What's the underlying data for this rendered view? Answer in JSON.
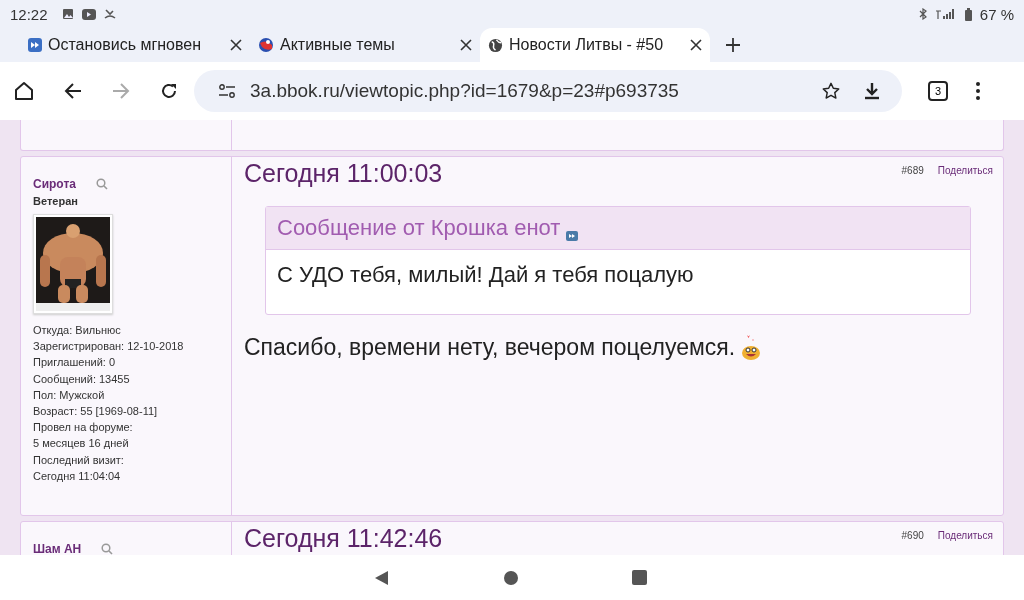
{
  "status_bar": {
    "time": "12:22",
    "battery": "67 %"
  },
  "tabs": [
    {
      "title": "Остановись мгновен",
      "selected": false,
      "kind": "forward"
    },
    {
      "title": "Активные темы",
      "selected": false,
      "kind": "ball"
    },
    {
      "title": "Новости Литвы - #50",
      "selected": true,
      "kind": "globe"
    }
  ],
  "address_bar": {
    "url": "3a.bbok.ru/viewtopic.php?id=1679&p=23#p693735",
    "tab_count": "3"
  },
  "posts": [
    {
      "author": "Сирота",
      "rank": "Ветеран",
      "profile": [
        "Откуда: Вильнюс",
        "Зарегистрирован: 12-10-2018",
        "Приглашений: 0",
        "Сообщений: 13455",
        "Пол: Мужской",
        "Возраст: 55 [1969-08-11]",
        "Провел на форуме:",
        "5 месяцев 16 дней",
        "Последний визит:",
        "Сегодня 11:04:04"
      ],
      "time": "Сегодня 11:00:03",
      "number": "#689",
      "share": "Поделиться",
      "quote": {
        "header": "Сообщение от Крошка енот",
        "text": "С УДО тебя, милый!  Дай я тебя поцалую"
      },
      "body": "Спасибо, времени нету, вечером поцелуемся."
    },
    {
      "author": "Шам АН",
      "time": "Сегодня 11:42:46",
      "number": "#690",
      "share": "Поделиться"
    }
  ]
}
